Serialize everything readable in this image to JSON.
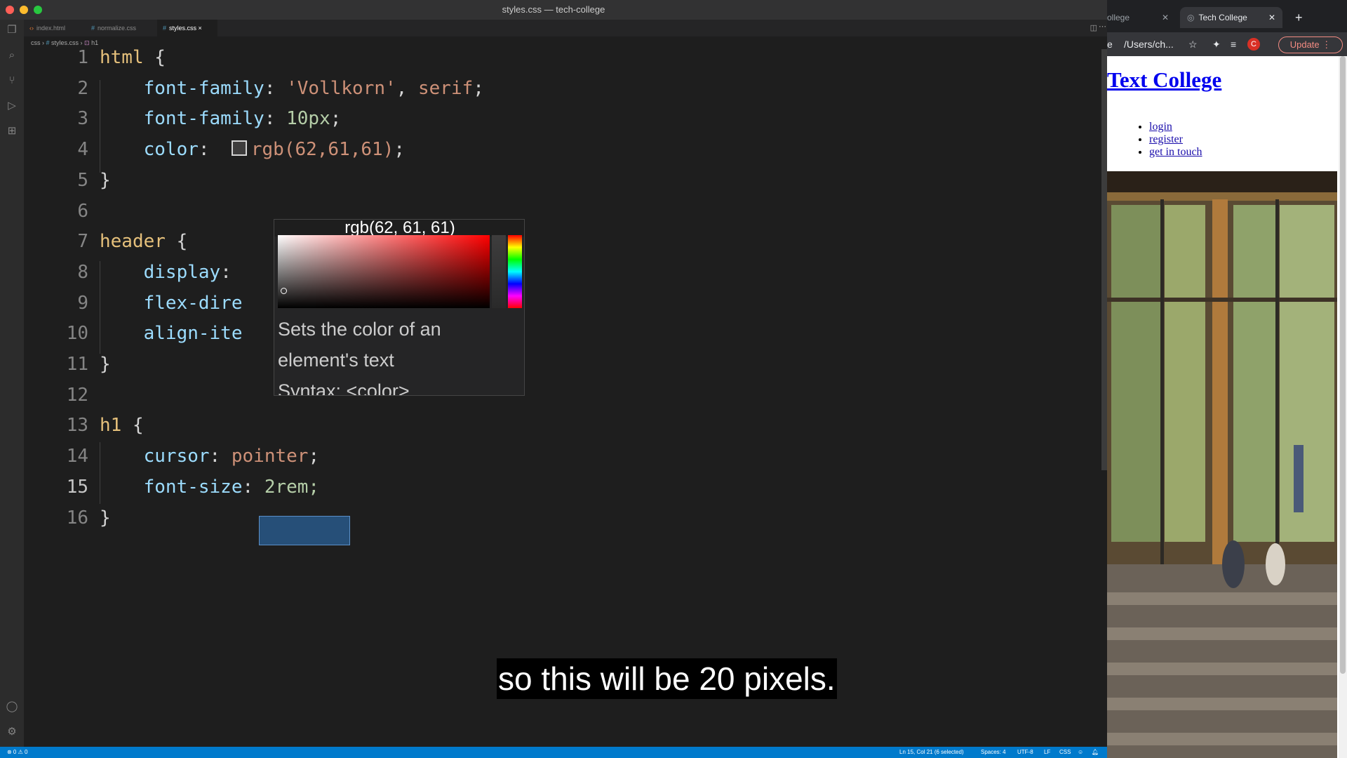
{
  "window_title": "styles.css — tech-college",
  "tabs": [
    {
      "icon": "‹›",
      "label": "index.html"
    },
    {
      "icon": "#",
      "label": "normalize.css"
    },
    {
      "icon": "#",
      "label": "styles.css",
      "close": "×"
    }
  ],
  "breadcrumb": {
    "folder": "css",
    "file": "styles.css",
    "symbol": "h1"
  },
  "editor": {
    "lines": [
      {
        "n": "1",
        "tokens": [
          {
            "t": "html",
            "c": "sel"
          },
          {
            "t": " {",
            "c": "brace"
          }
        ]
      },
      {
        "n": "2",
        "tokens": [
          {
            "t": "    font-family",
            "c": "prop"
          },
          {
            "t": ": ",
            "c": "pun"
          },
          {
            "t": "'Vollkorn'",
            "c": "val"
          },
          {
            "t": ", ",
            "c": "pun"
          },
          {
            "t": "serif",
            "c": "val"
          },
          {
            "t": ";",
            "c": "pun"
          }
        ]
      },
      {
        "n": "3",
        "tokens": [
          {
            "t": "    font-family",
            "c": "prop"
          },
          {
            "t": ": ",
            "c": "pun"
          },
          {
            "t": "10px",
            "c": "num"
          },
          {
            "t": ";",
            "c": "pun"
          }
        ]
      },
      {
        "n": "4",
        "tokens": [
          {
            "t": "    color",
            "c": "prop"
          },
          {
            "t": ":  ",
            "c": "pun"
          },
          {
            "t": "SWATCH",
            "c": "swatch"
          },
          {
            "t": "rgb(62,61,61)",
            "c": "val"
          },
          {
            "t": ";",
            "c": "pun"
          }
        ]
      },
      {
        "n": "5",
        "tokens": [
          {
            "t": "}",
            "c": "brace"
          }
        ]
      },
      {
        "n": "6",
        "tokens": []
      },
      {
        "n": "7",
        "tokens": [
          {
            "t": "header",
            "c": "sel"
          },
          {
            "t": " {",
            "c": "brace"
          }
        ]
      },
      {
        "n": "8",
        "tokens": [
          {
            "t": "    display",
            "c": "prop"
          },
          {
            "t": ":",
            "c": "pun"
          }
        ]
      },
      {
        "n": "9",
        "tokens": [
          {
            "t": "    flex-dire",
            "c": "prop"
          }
        ]
      },
      {
        "n": "10",
        "tokens": [
          {
            "t": "    align-ite",
            "c": "prop"
          }
        ]
      },
      {
        "n": "11",
        "tokens": [
          {
            "t": "}",
            "c": "brace"
          }
        ]
      },
      {
        "n": "12",
        "tokens": []
      },
      {
        "n": "13",
        "tokens": [
          {
            "t": "h1",
            "c": "sel"
          },
          {
            "t": " {",
            "c": "brace"
          }
        ]
      },
      {
        "n": "14",
        "tokens": [
          {
            "t": "    cursor",
            "c": "prop"
          },
          {
            "t": ": ",
            "c": "pun"
          },
          {
            "t": "pointer",
            "c": "val"
          },
          {
            "t": ";",
            "c": "pun"
          }
        ]
      },
      {
        "n": "15",
        "tokens": [
          {
            "t": "    font-size",
            "c": "prop"
          },
          {
            "t": ": ",
            "c": "pun"
          },
          {
            "t": "2rem;",
            "c": "num"
          }
        ]
      },
      {
        "n": "16",
        "tokens": [
          {
            "t": "}",
            "c": "brace"
          }
        ]
      }
    ],
    "current_line": "15",
    "selected_text": " 2rem;"
  },
  "color_picker": {
    "header": "rgb(62, 61, 61)",
    "selected_color": "#3e3d3d",
    "doc_line1": "Sets the color of an",
    "doc_line2": "element's text",
    "doc_line3": "Syntax: <color>"
  },
  "status_bar": {
    "errors": "⊗ 0 ⚠ 0",
    "position": "Ln 15, Col 21 (6 selected)",
    "spaces": "Spaces: 4",
    "encoding": "UTF-8",
    "eol": "LF",
    "language": "CSS"
  },
  "browser": {
    "tab_partial": "ollege",
    "tab_active": "Tech College",
    "address": "/Users/ch...",
    "address_prefix": "e",
    "profile_initial": "C",
    "update_label": "Update",
    "page_title": "Text College",
    "nav_links": [
      "login",
      "register",
      "get in touch"
    ]
  },
  "caption": "so this will be 20 pixels.",
  "colors": {
    "editor_bg": "#1e1e1e",
    "status_bg": "#007acc",
    "selection": "#264f78",
    "link": "#0000ee"
  }
}
